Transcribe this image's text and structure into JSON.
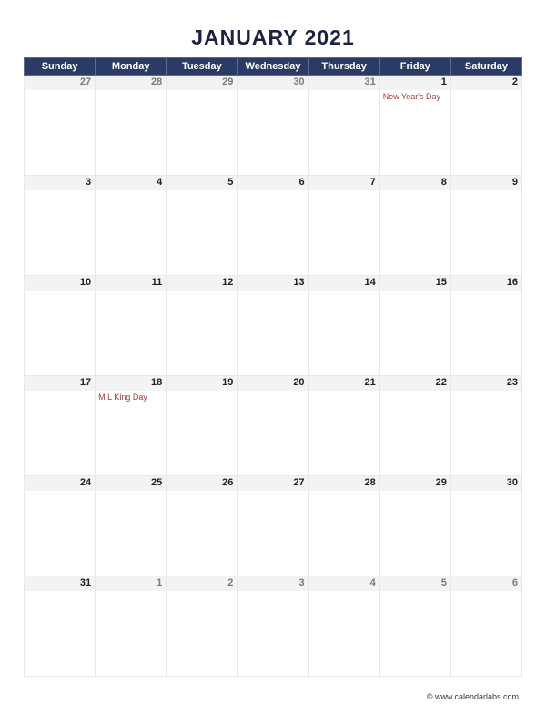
{
  "title": "JANUARY 2021",
  "day_headers": [
    "Sunday",
    "Monday",
    "Tuesday",
    "Wednesday",
    "Thursday",
    "Friday",
    "Saturday"
  ],
  "weeks": [
    [
      {
        "n": "27",
        "out": true
      },
      {
        "n": "28",
        "out": true
      },
      {
        "n": "29",
        "out": true
      },
      {
        "n": "30",
        "out": true
      },
      {
        "n": "31",
        "out": true
      },
      {
        "n": "1",
        "event": "New Year's Day"
      },
      {
        "n": "2"
      }
    ],
    [
      {
        "n": "3"
      },
      {
        "n": "4"
      },
      {
        "n": "5"
      },
      {
        "n": "6"
      },
      {
        "n": "7"
      },
      {
        "n": "8"
      },
      {
        "n": "9"
      }
    ],
    [
      {
        "n": "10"
      },
      {
        "n": "11"
      },
      {
        "n": "12"
      },
      {
        "n": "13"
      },
      {
        "n": "14"
      },
      {
        "n": "15"
      },
      {
        "n": "16"
      }
    ],
    [
      {
        "n": "17"
      },
      {
        "n": "18",
        "event": "M L King Day"
      },
      {
        "n": "19"
      },
      {
        "n": "20"
      },
      {
        "n": "21"
      },
      {
        "n": "22"
      },
      {
        "n": "23"
      }
    ],
    [
      {
        "n": "24"
      },
      {
        "n": "25"
      },
      {
        "n": "26"
      },
      {
        "n": "27"
      },
      {
        "n": "28"
      },
      {
        "n": "29"
      },
      {
        "n": "30"
      }
    ],
    [
      {
        "n": "31"
      },
      {
        "n": "1",
        "out": true
      },
      {
        "n": "2",
        "out": true
      },
      {
        "n": "3",
        "out": true
      },
      {
        "n": "4",
        "out": true
      },
      {
        "n": "5",
        "out": true
      },
      {
        "n": "6",
        "out": true
      }
    ]
  ],
  "footer": "© www.calendarlabs.com"
}
